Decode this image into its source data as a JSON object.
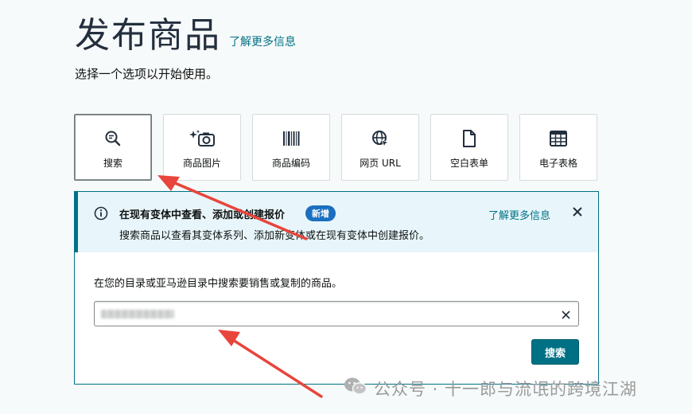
{
  "header": {
    "title": "发布商品",
    "learn_more": "了解更多信息",
    "subtitle": "选择一个选项以开始使用。"
  },
  "tiles": [
    {
      "label": "搜索",
      "icon": "search-icon",
      "active": true
    },
    {
      "label": "商品图片",
      "icon": "camera-sparkle-icon",
      "active": false
    },
    {
      "label": "商品编码",
      "icon": "barcode-icon",
      "active": false
    },
    {
      "label": "网页 URL",
      "icon": "globe-icon",
      "active": false
    },
    {
      "label": "空白表单",
      "icon": "document-icon",
      "active": false
    },
    {
      "label": "电子表格",
      "icon": "spreadsheet-icon",
      "active": false
    }
  ],
  "banner": {
    "title": "在现有变体中查看、添加或创建报价",
    "badge": "新增",
    "body": "搜索商品以查看其变体系列、添加新变体或在现有变体中创建报价。",
    "learn_more": "了解更多信息"
  },
  "search": {
    "instruction": "在您的目录或亚马逊目录中搜索要销售或复制的商品。",
    "value": "",
    "button_label": "搜索"
  },
  "watermark": {
    "text": "公众号 · 十一郎与流氓的跨境江湖"
  },
  "colors": {
    "accent": "#007185",
    "badge": "#1a6fc0",
    "annotation_arrow": "#e8453c"
  }
}
